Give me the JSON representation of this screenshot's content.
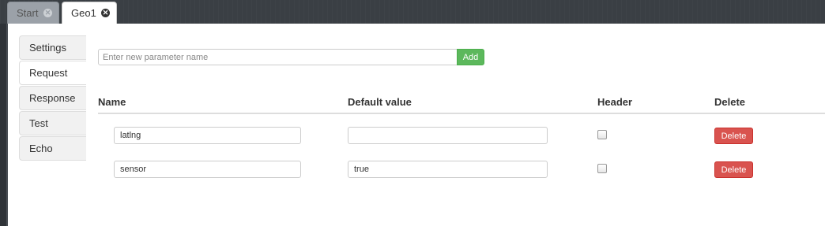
{
  "tabs": [
    {
      "label": "Start",
      "active": false
    },
    {
      "label": "Geo1",
      "active": true
    }
  ],
  "sidenav": {
    "items": [
      "Settings",
      "Request",
      "Response",
      "Test",
      "Echo"
    ],
    "active": "Request"
  },
  "add_param": {
    "placeholder": "Enter new parameter name",
    "value": "",
    "button_label": "Add"
  },
  "table": {
    "headers": {
      "name": "Name",
      "default_value": "Default value",
      "header": "Header",
      "delete": "Delete"
    },
    "rows": [
      {
        "name": "latlng",
        "default_value": "",
        "header": false,
        "delete_label": "Delete"
      },
      {
        "name": "sensor",
        "default_value": "true",
        "header": false,
        "delete_label": "Delete"
      }
    ]
  },
  "colors": {
    "add_button": "#5cb85c",
    "delete_button": "#d9534f",
    "topbar": "#3a3f44"
  }
}
